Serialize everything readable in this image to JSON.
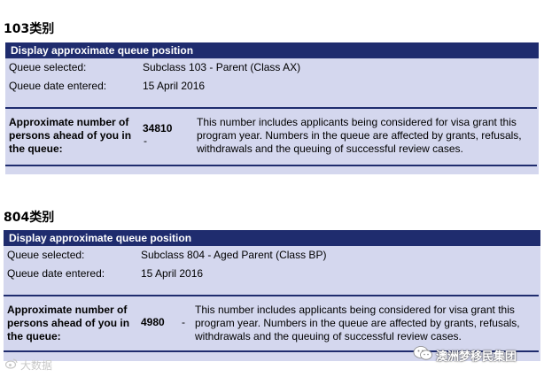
{
  "sections": [
    {
      "heading": "103类别",
      "panel_title": "Display approximate queue position",
      "queue_selected_label": "Queue selected:",
      "queue_selected_value": "Subclass 103 - Parent (Class AX)",
      "queue_date_label": "Queue date entered:",
      "queue_date_value": "15 April 2016",
      "persons_label": "Approximate number of persons ahead of you in the queue:",
      "persons_value": "34810",
      "persons_dash": "-",
      "note": "This number includes applicants being considered for visa grant this program year. Numbers in the queue are affected by grants, refusals, withdrawals and the queuing of successful review cases."
    },
    {
      "heading": "804类别",
      "panel_title": "Display approximate queue position",
      "queue_selected_label": "Queue selected:",
      "queue_selected_value": "Subclass 804 - Aged Parent (Class BP)",
      "queue_date_label": "Queue date entered:",
      "queue_date_value": "15 April 2016",
      "persons_label": "Approximate number of persons ahead of you in the queue:",
      "persons_value": "4980",
      "persons_dash": "-",
      "note": "This number includes applicants being considered for visa grant this program year. Numbers in the queue are affected by grants, refusals, withdrawals and the queuing of successful review cases."
    }
  ],
  "watermarks": {
    "left_text": "大数据",
    "right_text": "澳洲梦移民集团",
    "left_icon": "weibo-icon",
    "right_icon": "wechat-icon"
  }
}
